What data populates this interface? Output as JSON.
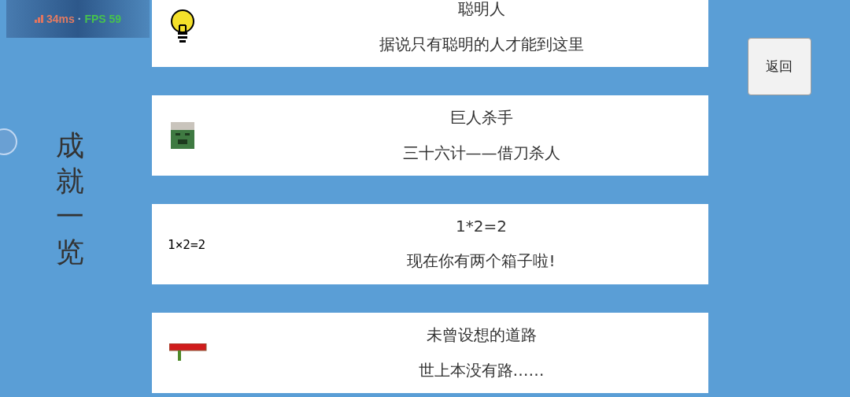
{
  "perf": {
    "latency": "34ms",
    "separator": "·",
    "fps": "FPS 59"
  },
  "title": "成就一览",
  "achievements": [
    {
      "kind": "bulb",
      "name": "聪明人",
      "description": "据说只有聪明的人才能到这里"
    },
    {
      "kind": "zombie",
      "name": "巨人杀手",
      "description": "三十六计——借刀杀人"
    },
    {
      "kind": "text",
      "icon_text": "1×2=2",
      "name": "1*2=2",
      "description": "现在你有两个箱子啦!"
    },
    {
      "kind": "sign",
      "name": "未曾设想的道路",
      "description": "世上本没有路……"
    }
  ],
  "back_button": "返回"
}
